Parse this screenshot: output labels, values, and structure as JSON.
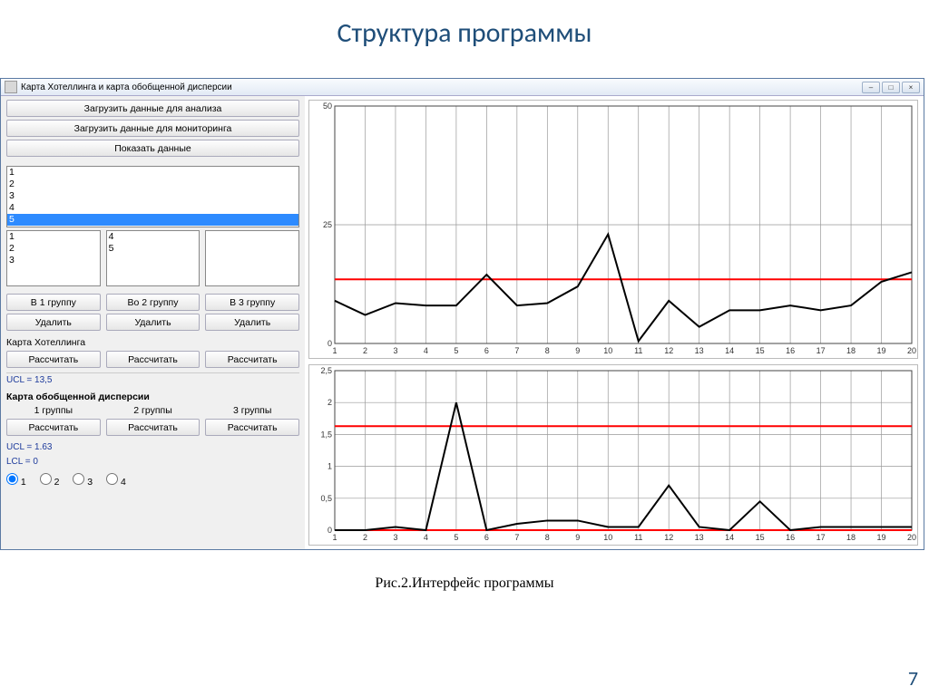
{
  "slide": {
    "title": "Структура программы",
    "caption": "Рис.2.Интерфейс программы",
    "number": "7"
  },
  "window": {
    "title": "Карта Хотеллинга и карта обобщенной дисперсии",
    "btn_load_analysis": "Загрузить данные для анализа",
    "btn_load_monitor": "Загрузить данные для мониторинга",
    "btn_show": "Показать данные",
    "list_main": [
      "1",
      "2",
      "3",
      "4",
      "5"
    ],
    "list_main_selected": 4,
    "list_g1": [
      "1",
      "2",
      "3"
    ],
    "list_g2": [
      "4",
      "5"
    ],
    "list_g3": [],
    "btn_to1": "В 1 группу",
    "btn_to2": "Во 2 группу",
    "btn_to3": "В 3 группу",
    "btn_del": "Удалить",
    "section_hotelling": "Карта Хотеллинга",
    "btn_calc": "Рассчитать",
    "ucl1": "UCL  =  13,5",
    "section_disp": "Карта обобщенной дисперсии",
    "grp1": "1 группы",
    "grp2": "2 группы",
    "grp3": "3 группы",
    "ucl2": "UCL = 1.63",
    "lcl2": "LCL = 0",
    "radio": [
      "1",
      "2",
      "3",
      "4"
    ]
  },
  "chart_data": [
    {
      "type": "line",
      "x": [
        1,
        2,
        3,
        4,
        5,
        6,
        7,
        8,
        9,
        10,
        11,
        12,
        13,
        14,
        15,
        16,
        17,
        18,
        19,
        20
      ],
      "values": [
        9,
        6,
        8.5,
        8,
        8,
        14.5,
        8,
        8.5,
        12,
        23,
        0.5,
        9,
        3.5,
        7,
        7,
        8,
        7,
        8,
        13,
        15
      ],
      "ucl": 13.5,
      "ylim": [
        0,
        50
      ],
      "yticks": [
        0,
        25,
        50
      ]
    },
    {
      "type": "line",
      "x": [
        1,
        2,
        3,
        4,
        5,
        6,
        7,
        8,
        9,
        10,
        11,
        12,
        13,
        14,
        15,
        16,
        17,
        18,
        19,
        20
      ],
      "values": [
        0,
        0,
        0.05,
        0,
        2,
        0,
        0.1,
        0.15,
        0.15,
        0.05,
        0.05,
        0.7,
        0.05,
        0,
        0.45,
        0,
        0.05,
        0.05,
        0.05,
        0.05
      ],
      "ucl": 1.63,
      "lcl": 0,
      "ylim": [
        0,
        2.5
      ],
      "yticks": [
        0,
        0.5,
        1,
        1.5,
        2,
        2.5
      ]
    }
  ]
}
